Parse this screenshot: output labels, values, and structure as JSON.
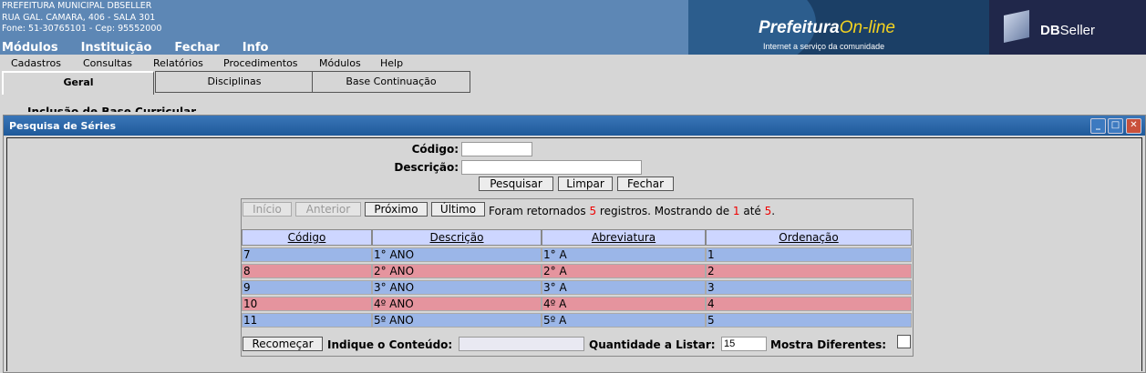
{
  "header": {
    "org_lines": [
      "PREFEITURA MUNICIPAL DBSELLER",
      "RUA GAL. CAMARA, 406 - SALA 301",
      "Fone: 51-30765101  -  Cep: 95552000"
    ],
    "main_menu": [
      "Módulos",
      "Instituição",
      "Fechar",
      "Info"
    ],
    "brand_main": "Prefeitura",
    "brand_online": "On-line",
    "brand_sub": "Internet a serviço da comunidade",
    "dbseller_bold": "DB",
    "dbseller_rest": "Seller"
  },
  "submenu": [
    "Cadastros",
    "Consultas",
    "Relatórios",
    "Procedimentos",
    "Módulos",
    "Help"
  ],
  "tabs": [
    "Geral",
    "Disciplinas",
    "Base Continuação"
  ],
  "background_text": "Inclusão de Base Curricular",
  "window": {
    "title": "Pesquisa de Séries",
    "search": {
      "codigo_label": "Código:",
      "codigo_value": "",
      "descricao_label": "Descrição:",
      "descricao_value": "",
      "pesquisar": "Pesquisar",
      "limpar": "Limpar",
      "fechar": "Fechar"
    },
    "nav": {
      "inicio": "Início",
      "anterior": "Anterior",
      "proximo": "Próximo",
      "ultimo": "Último"
    },
    "info": {
      "pre": "Foram retornados",
      "total": "5",
      "mid": "registros. Mostrando de",
      "from": "1",
      "ate": "até",
      "to": "5",
      "end": "."
    },
    "columns": [
      "Código",
      "Descrição",
      "Abreviatura",
      "Ordenação"
    ],
    "rows": [
      [
        "7",
        "1° ANO",
        "1° A",
        "1"
      ],
      [
        "8",
        "2° ANO",
        "2° A",
        "2"
      ],
      [
        "9",
        "3° ANO",
        "3° A",
        "3"
      ],
      [
        "10",
        "4º ANO",
        "4º A",
        "4"
      ],
      [
        "11",
        "5º ANO",
        "5º A",
        "5"
      ]
    ],
    "footer": {
      "recomecar": "Recomeçar",
      "indique_label": "Indique o Conteúdo:",
      "indique_value": "",
      "quantidade_label": "Quantidade a Listar:",
      "quantidade_value": "15",
      "mostra_label": "Mostra Diferentes:"
    }
  }
}
